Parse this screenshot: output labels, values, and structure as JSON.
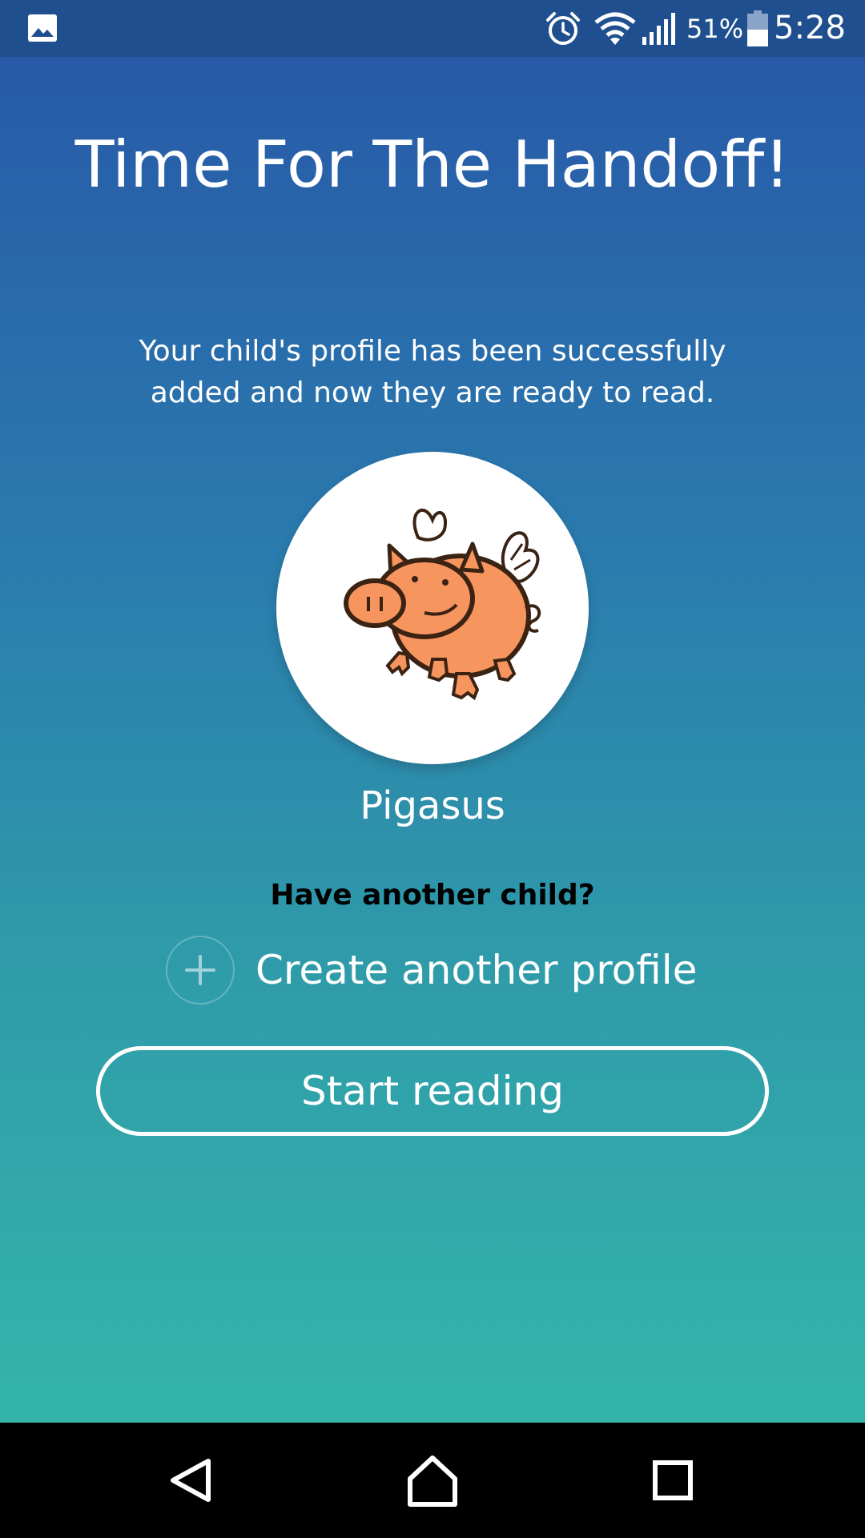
{
  "status_bar": {
    "battery_percent": "51%",
    "time": "5:28",
    "icons": [
      "gallery-icon",
      "alarm-icon",
      "wifi-icon",
      "signal-icon",
      "battery-icon"
    ]
  },
  "main": {
    "title": "Time For The Handoff!",
    "subtitle": "Your child's profile has been successfully added and now they are ready to read.",
    "profile": {
      "name": "Pigasus",
      "avatar_icon": "flying-pig-icon"
    },
    "another_child_prompt": "Have another child?",
    "create_profile_label": "Create another profile",
    "start_reading_label": "Start reading"
  },
  "nav_bar": {
    "icons": [
      "back-icon",
      "home-icon",
      "recents-icon"
    ]
  },
  "colors": {
    "gradient_top": "#285aa8",
    "gradient_bottom": "#34b5a9",
    "status_bar": "#1f4f8e",
    "pig_fill": "#f7955f",
    "pig_outline": "#3b2314"
  }
}
